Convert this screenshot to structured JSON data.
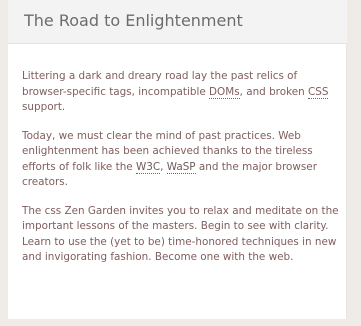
{
  "section": {
    "title": "The Road to Enlightenment",
    "paragraphs": [
      {
        "part1": "Littering a dark and dreary road lay the past relics of browser-specific tags, incompatible ",
        "doms": "DOMs",
        "part2": ", and broken ",
        "css": "CSS",
        "part3": " support."
      },
      {
        "part1": "Today, we must clear the mind of past practices. Web enlightenment has been achieved thanks to the tireless efforts of folk like the ",
        "w3c": "W3C",
        "part2": ", ",
        "wasp": "WaSP",
        "part3": " and the major browser creators."
      },
      {
        "text": "The css Zen Garden invites you to relax and meditate on the important lessons of the masters. Begin to see with clarity. Learn to use the (yet to be) time-honored techniques in new and invigorating fashion. Become one with the web."
      }
    ]
  }
}
